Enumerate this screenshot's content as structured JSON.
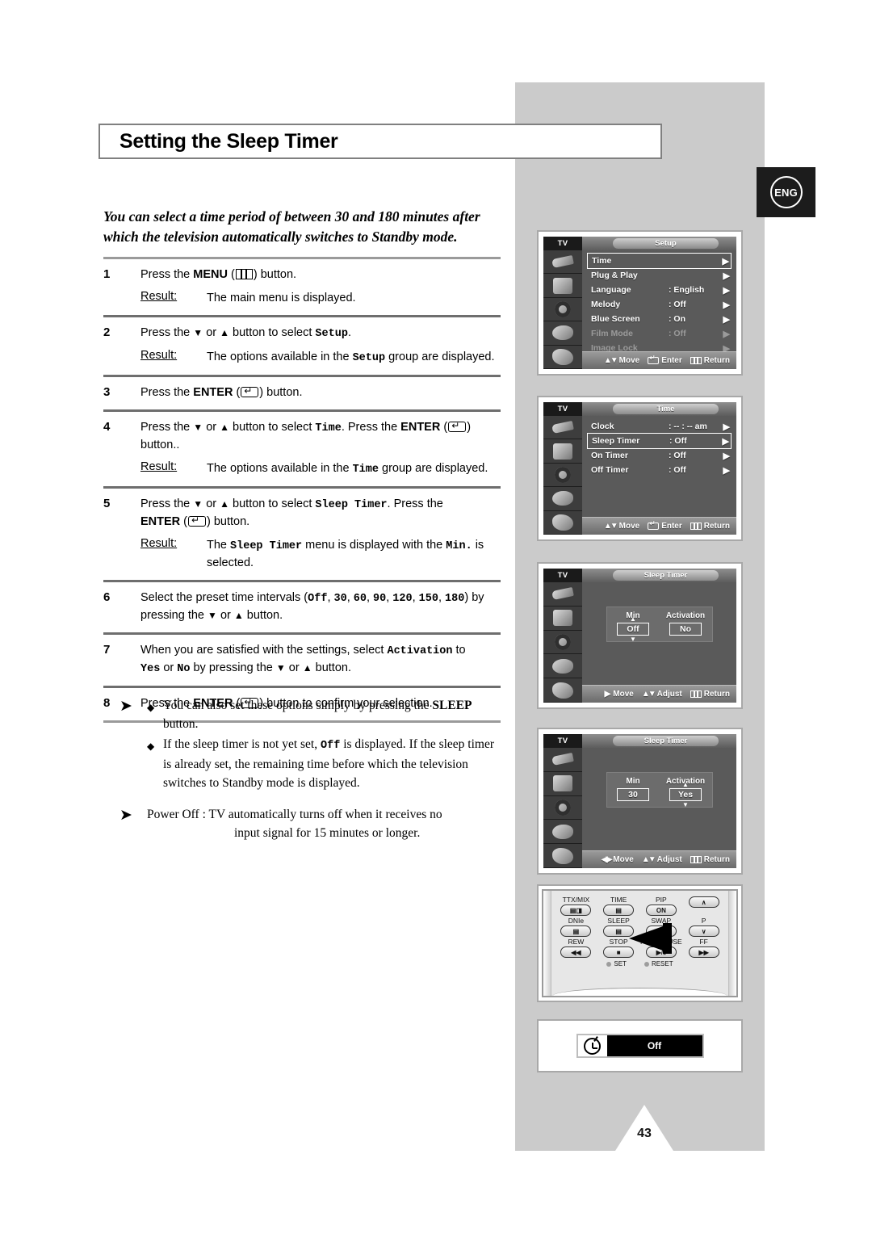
{
  "page": {
    "title": "Setting the Sleep Timer",
    "language_badge": "ENG",
    "page_number": "43",
    "intro": "You can select a time period of between 30 and 180 minutes after which the television automatically switches to Standby mode."
  },
  "steps": [
    {
      "num": "1",
      "instruction_pre": "Press the ",
      "instruction_bold": "MENU",
      "instruction_mid": " (",
      "icon": "menu-icon",
      "instruction_post": ") button.",
      "result_label": "Result:",
      "result_text": "The main menu is displayed."
    },
    {
      "num": "2",
      "instruction": "Press the ▼ or ▲ button to select Setup.",
      "result_label": "Result:",
      "result_text": "The options available in the Setup group are displayed."
    },
    {
      "num": "3",
      "instruction": "Press the ENTER (  ) button.",
      "result_label": "",
      "result_text": ""
    },
    {
      "num": "4",
      "instruction": "Press the ▼ or ▲ button to select Time. Press the ENTER (  ) button..",
      "result_label": "Result:",
      "result_text": "The options available in the Time group are displayed."
    },
    {
      "num": "5",
      "instruction": "Press the ▼ or ▲ button to select Sleep Timer. Press the ENTER (  ) button.",
      "result_label": "Result:",
      "result_text": "The Sleep Timer menu is displayed with the Min. is selected."
    },
    {
      "num": "6",
      "instruction": "Select the preset time intervals (Off, 30, 60, 90, 120, 150, 180) by pressing the ▼ or ▲ button.",
      "result_label": "",
      "result_text": ""
    },
    {
      "num": "7",
      "instruction": "When you are satisfied with the settings, select Activation to Yes or No by pressing the ▼ or ▲ button.",
      "result_label": "",
      "result_text": ""
    },
    {
      "num": "8",
      "instruction": "Press the ENTER (  ) button to confirm your selection.",
      "result_label": "",
      "result_text": ""
    }
  ],
  "step_tokens": {
    "press_the": "Press the ",
    "menu": "MENU",
    "enter": "ENTER",
    "button_dot": ") button.",
    "button_dotdot": ") button..",
    "open_paren": " (",
    "or": " or ",
    "button_to_select": " button to select ",
    "setup": "Setup",
    "time": "Time",
    "sleep_timer": "Sleep Timer",
    "min_dot": "Min.",
    "activation": "Activation",
    "yes": "Yes",
    "no": "No",
    "off": "Off",
    "result": "Result:",
    "down_tri": "▼",
    "up_tri": "▲",
    "r1": "The main menu is displayed.",
    "r2a": "The options available in the ",
    "r2b": " group are displayed.",
    "s2_tail": ".",
    "s4_mid": ". Press the ",
    "s5_press_the": ". Press the ",
    "s5_result_a": "The ",
    "s5_result_b": " menu is displayed with the ",
    "s5_result_c": " is selected.",
    "s6_a": "Select the preset time intervals (",
    "s6_b": ") by pressing the ",
    "s6_c": " button.",
    "s6_values": [
      "Off",
      "30",
      "60",
      "90",
      "120",
      "150",
      "180"
    ],
    "s7_a": "When you are satisfied with the settings, select ",
    "s7_b": " to ",
    "s7_c": " or ",
    "s7_d": " by pressing the ",
    "s7_e": " button.",
    "s8_tail": ") button to confirm your selection."
  },
  "notes": [
    {
      "arrow": "➤",
      "bullets": [
        {
          "marker": "◆",
          "text_a": "You can also set these options simply by pressing the ",
          "bold": "SLEEP",
          "text_b": " button."
        },
        {
          "marker": "◆",
          "text_a": "If the sleep timer is not yet set, ",
          "bold": "Off",
          "text_b": " is displayed.",
          "extra": "If the sleep timer is already set, the remaining time before which the television switches to Standby mode is displayed."
        }
      ]
    },
    {
      "arrow": "➤",
      "power_off_label": "Power Off : ",
      "power_off_text": "TV automatically turns off when it receives no",
      "power_off_text2": "input signal for 15 minutes or longer."
    }
  ],
  "osd": {
    "setup": {
      "tv_label": "TV",
      "title": "Setup",
      "rows": [
        {
          "label": "Time",
          "value": "",
          "arrow": "▶",
          "selected": true,
          "dim": false
        },
        {
          "label": "Plug & Play",
          "value": "",
          "arrow": "▶",
          "selected": false,
          "dim": false
        },
        {
          "label": "Language",
          "value": ": English",
          "arrow": "▶",
          "selected": false,
          "dim": false
        },
        {
          "label": "Melody",
          "value": ": Off",
          "arrow": "▶",
          "selected": false,
          "dim": false
        },
        {
          "label": "Blue Screen",
          "value": ": On",
          "arrow": "▶",
          "selected": false,
          "dim": false
        },
        {
          "label": "Film Mode",
          "value": ": Off",
          "arrow": "▶",
          "selected": false,
          "dim": true
        },
        {
          "label": "Image Lock",
          "value": "",
          "arrow": "▶",
          "selected": false,
          "dim": true
        }
      ],
      "footer": [
        {
          "icon": "up-down-icon",
          "label": "Move"
        },
        {
          "icon": "enter-icon",
          "label": "Enter"
        },
        {
          "icon": "return-icon",
          "label": "Return"
        }
      ]
    },
    "time": {
      "tv_label": "TV",
      "title": "Time",
      "rows": [
        {
          "label": "Clock",
          "value": ": -- : --   am",
          "arrow": "▶",
          "selected": false,
          "dim": false
        },
        {
          "label": "Sleep Timer",
          "value": ": Off",
          "arrow": "▶",
          "selected": true,
          "dim": false
        },
        {
          "label": "On Timer",
          "value": ": Off",
          "arrow": "▶",
          "selected": false,
          "dim": false
        },
        {
          "label": "Off Timer",
          "value": ": Off",
          "arrow": "▶",
          "selected": false,
          "dim": false
        }
      ],
      "footer": [
        {
          "icon": "up-down-icon",
          "label": "Move"
        },
        {
          "icon": "enter-icon",
          "label": "Enter"
        },
        {
          "icon": "return-icon",
          "label": "Return"
        }
      ]
    },
    "sleep_off": {
      "tv_label": "TV",
      "title": "Sleep Timer",
      "col_min": "Min",
      "col_activation": "Activation",
      "min_value": "Off",
      "activation_value": "No",
      "min_selected": true,
      "activation_selected": false,
      "footer": [
        {
          "icon": "right-arrow-icon",
          "label": "Move"
        },
        {
          "icon": "up-down-icon",
          "label": "Adjust"
        },
        {
          "icon": "return-icon",
          "label": "Return"
        }
      ]
    },
    "sleep_30": {
      "tv_label": "TV",
      "title": "Sleep Timer",
      "col_min": "Min",
      "col_activation": "Activation",
      "min_value": "30",
      "activation_value": "Yes",
      "min_selected": false,
      "activation_selected": true,
      "footer": [
        {
          "icon": "left-right-arrow-icon",
          "label": "Move"
        },
        {
          "icon": "up-down-icon",
          "label": "Adjust"
        },
        {
          "icon": "return-icon",
          "label": "Return"
        }
      ]
    }
  },
  "remote": {
    "buttons": [
      {
        "label": "TTX/MIX",
        "glyph": "▤◨"
      },
      {
        "label": "TIME",
        "glyph": "▤"
      },
      {
        "label": "PIP",
        "glyph": "ON"
      },
      {
        "label": "",
        "glyph": "∧"
      },
      {
        "label": "DNIe",
        "glyph": "▤"
      },
      {
        "label": "SLEEP",
        "glyph": "▤"
      },
      {
        "label": "SWAP",
        "glyph": ""
      },
      {
        "label": "P",
        "glyph": "∨"
      },
      {
        "label": "REW",
        "glyph": "◀◀"
      },
      {
        "label": "STOP",
        "glyph": "■"
      },
      {
        "label": "PLAY/PAUSE",
        "glyph": "▶/Ⅱ"
      },
      {
        "label": "FF",
        "glyph": "▶▶"
      }
    ],
    "set_label": "SET",
    "reset_label": "RESET",
    "pointer": "left-arrow-pointer"
  },
  "osd_popup": {
    "icon": "clock-icon",
    "value": "Off"
  }
}
